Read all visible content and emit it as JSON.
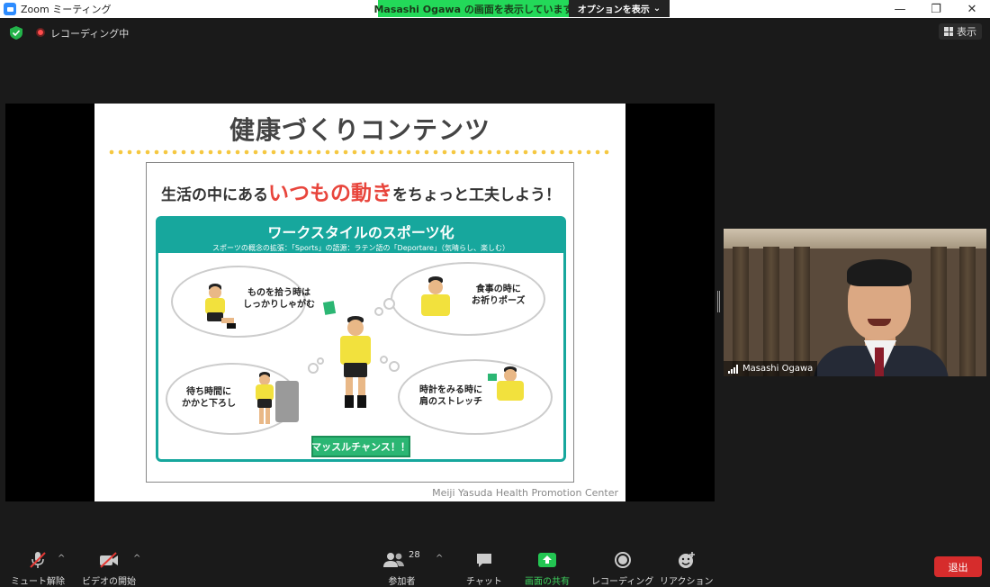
{
  "window": {
    "title": "Zoom ミーティング"
  },
  "share_banner": {
    "text": "Masashi Ogawa の画面を表示しています",
    "options_label": "オプションを表示"
  },
  "window_controls": {
    "minimize": "—",
    "restore": "❐",
    "close": "✕"
  },
  "status": {
    "recording_label": "レコーディング中",
    "view_label": "表示"
  },
  "slide": {
    "title": "健康づくりコンテンツ",
    "headline_pre": "生活の中にある",
    "headline_highlight": "いつもの動き",
    "headline_post": "をちょっと工夫しよう！",
    "panel_title": "ワークスタイルのスポーツ化",
    "panel_subtitle": "スポーツの概念の拡張：「Sports」の語源：ラテン語の「Deportare」（気晴らし、楽しむ）",
    "bubbles": [
      {
        "line1": "ものを拾う時は",
        "line2": "しっかりしゃがむ"
      },
      {
        "line1": "食事の時に",
        "line2": "お祈りポーズ"
      },
      {
        "line1": "待ち時間に",
        "line2": "かかと下ろし"
      },
      {
        "line1": "時計をみる時に",
        "line2": "肩のストレッチ"
      }
    ],
    "cta": "マッスルチャンス！！",
    "credit": "Meiji Yasuda Health Promotion Center"
  },
  "video": {
    "participant_name": "Masashi Ogawa"
  },
  "toolbar": {
    "mute_label": "ミュート解除",
    "video_label": "ビデオの開始",
    "participants_label": "参加者",
    "participants_count": "28",
    "chat_label": "チャット",
    "share_label": "画面の共有",
    "record_label": "レコーディング",
    "reaction_label": "リアクション",
    "leave_label": "退出"
  },
  "colors": {
    "share_green": "#23d959",
    "teal": "#17a79d",
    "leave_red": "#d62c2c",
    "highlight_red": "#e8453c"
  }
}
